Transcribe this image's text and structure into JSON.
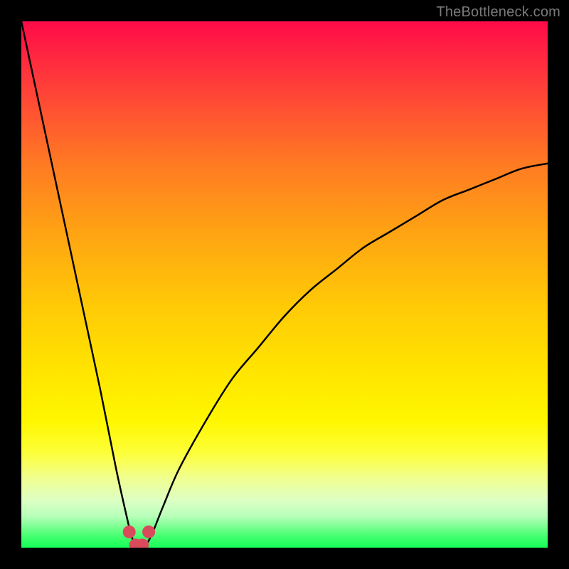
{
  "watermark": "TheBottleneck.com",
  "colors": {
    "frame": "#000000",
    "curve": "#000000",
    "markers": "#d94a5a",
    "gradient_top": "#ff0a48",
    "gradient_bottom": "#15ff57"
  },
  "chart_data": {
    "type": "line",
    "title": "",
    "xlabel": "",
    "ylabel": "",
    "xlim": [
      0,
      100
    ],
    "ylim": [
      0,
      100
    ],
    "grid": false,
    "legend": false,
    "description": "Bottleneck percentage curve. Minimum (~0% bottleneck) near x≈22; rises steeply toward x=0 (~100%) and gradually toward x=100 (~73%).",
    "series": [
      {
        "name": "bottleneck-curve",
        "x": [
          0,
          3,
          6,
          9,
          12,
          15,
          18,
          20,
          21,
          22,
          23,
          24,
          25,
          27,
          30,
          35,
          40,
          45,
          50,
          55,
          60,
          65,
          70,
          75,
          80,
          85,
          90,
          95,
          100
        ],
        "y": [
          100,
          86,
          72,
          58,
          44,
          30,
          15,
          6,
          2,
          0,
          0,
          1,
          3,
          8,
          15,
          24,
          32,
          38,
          44,
          49,
          53,
          57,
          60,
          63,
          66,
          68,
          70,
          72,
          73
        ]
      }
    ],
    "markers": [
      {
        "x": 20.5,
        "y": 3
      },
      {
        "x": 21.7,
        "y": 0.5
      },
      {
        "x": 23.0,
        "y": 0.5
      },
      {
        "x": 24.2,
        "y": 3
      }
    ]
  }
}
